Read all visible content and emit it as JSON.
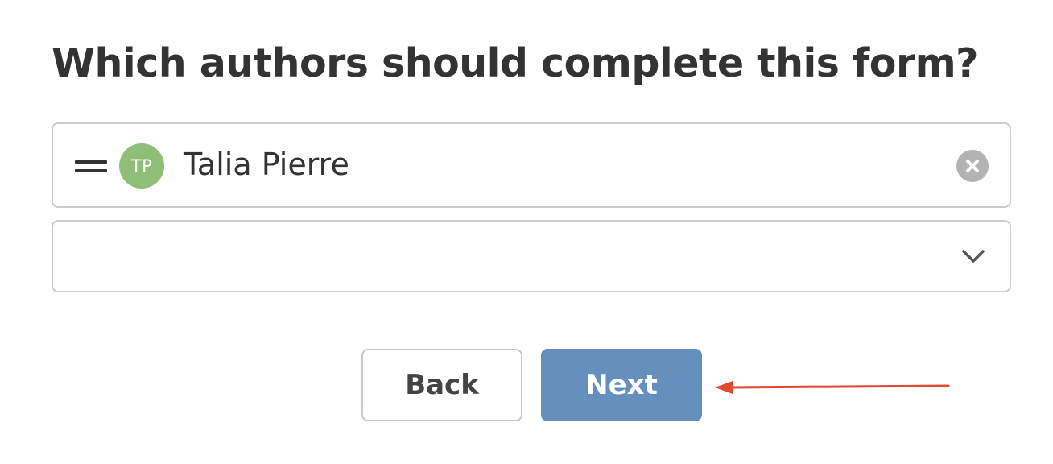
{
  "heading": "Which authors should complete this form?",
  "authors": [
    {
      "initials": "TP",
      "name": "Talia Pierre",
      "avatar_color": "#8fbe77"
    }
  ],
  "author_select": {
    "value": ""
  },
  "buttons": {
    "back_label": "Back",
    "next_label": "Next"
  },
  "icons": {
    "drag": "drag-handle-icon",
    "remove": "clear-circle-x-icon",
    "dropdown": "chevron-down-icon",
    "annotation": "red-arrow-left-icon"
  },
  "colors": {
    "primary_button": "#6590bd",
    "annotation_arrow": "#e04a33",
    "border": "#cccccc",
    "text": "#333333"
  }
}
